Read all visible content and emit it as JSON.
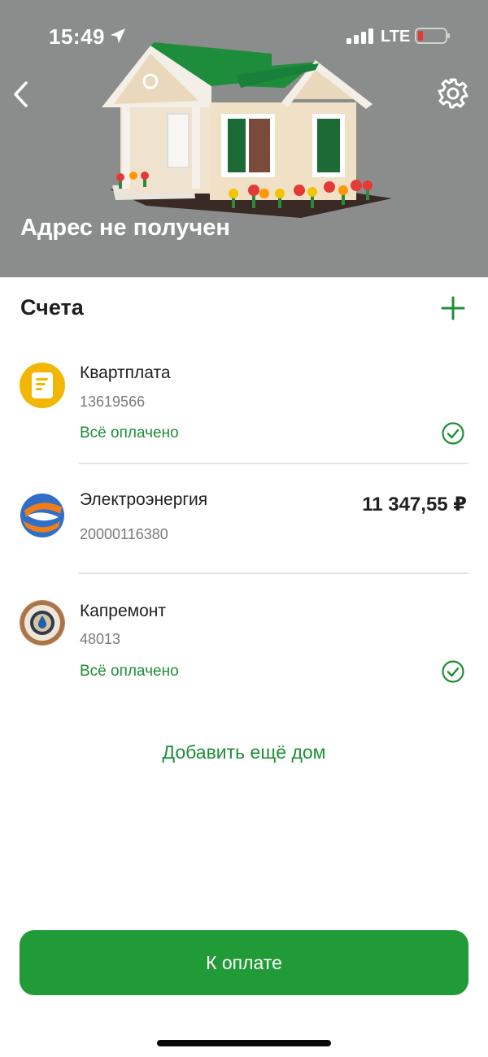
{
  "status_bar": {
    "time": "15:49",
    "network": "LTE"
  },
  "header": {
    "address": "Адрес не получен",
    "bg_color": "#8a8d8c"
  },
  "accounts_section": {
    "title": "Счета",
    "items": [
      {
        "name": "Квартплата",
        "number": "13619566",
        "status": "Всё оплачено",
        "icon": "document-icon"
      },
      {
        "name": "Электроэнергия",
        "number": "20000116380",
        "amount": "11 347,55 ₽",
        "icon": "electricity-logo-icon"
      },
      {
        "name": "Капремонт",
        "number": "48013",
        "status": "Всё оплачено",
        "icon": "water-drop-icon"
      }
    ]
  },
  "add_house_label": "Добавить ещё дом",
  "pay_button_label": "К оплате",
  "colors": {
    "accent_green": "#219a38",
    "status_green": "#1e8f36",
    "battery_low": "#e53935"
  }
}
